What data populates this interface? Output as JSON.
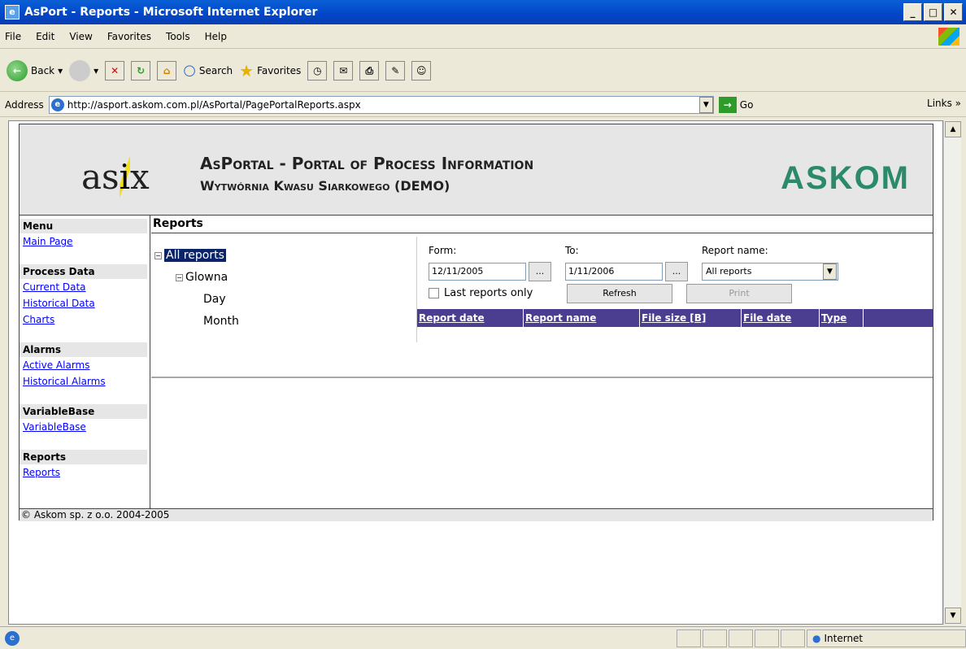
{
  "window": {
    "title": "AsPort - Reports - Microsoft Internet Explorer"
  },
  "menu": [
    "File",
    "Edit",
    "View",
    "Favorites",
    "Tools",
    "Help"
  ],
  "toolbar": {
    "back": "Back",
    "search": "Search",
    "favorites": "Favorites"
  },
  "address": {
    "label": "Address",
    "url": "http://asport.askom.com.pl/AsPortal/PagePortalReports.aspx",
    "go": "Go",
    "links": "Links"
  },
  "header": {
    "logo": "asix",
    "title": "AsPortal - Portal of Process Information",
    "subtitle": "Wytwórnia Kwasu Siarkowego (DEMO)",
    "brand": "ASKOM"
  },
  "sidebar": {
    "menu_label": "Menu",
    "main_page": "Main Page",
    "process_data": "Process Data",
    "current_data": "Current Data",
    "historical_data": "Historical Data",
    "charts": "Charts",
    "alarms": "Alarms",
    "active_alarms": "Active Alarms",
    "historical_alarms": "Historical Alarms",
    "variablebase_head": "VariableBase",
    "variablebase": "VariableBase",
    "reports_head": "Reports",
    "reports": "Reports"
  },
  "main": {
    "title": "Reports",
    "tree": {
      "root": "All reports",
      "folder": "Glowna",
      "day": "Day",
      "month": "Month"
    },
    "form_label": "Form:",
    "to_label": "To:",
    "report_name_label": "Report name:",
    "from_value": "12/11/2005",
    "to_value": "1/11/2006",
    "ellipsis": "...",
    "report_name_value": "All reports",
    "last_only": "Last reports only",
    "refresh": "Refresh",
    "print": "Print",
    "columns": [
      "Report date",
      "Report name",
      "File size [B]",
      "File date",
      "Type"
    ]
  },
  "footer": {
    "copyright": "© Askom sp. z o.o. 2004-2005"
  },
  "status": {
    "zone": "Internet"
  }
}
